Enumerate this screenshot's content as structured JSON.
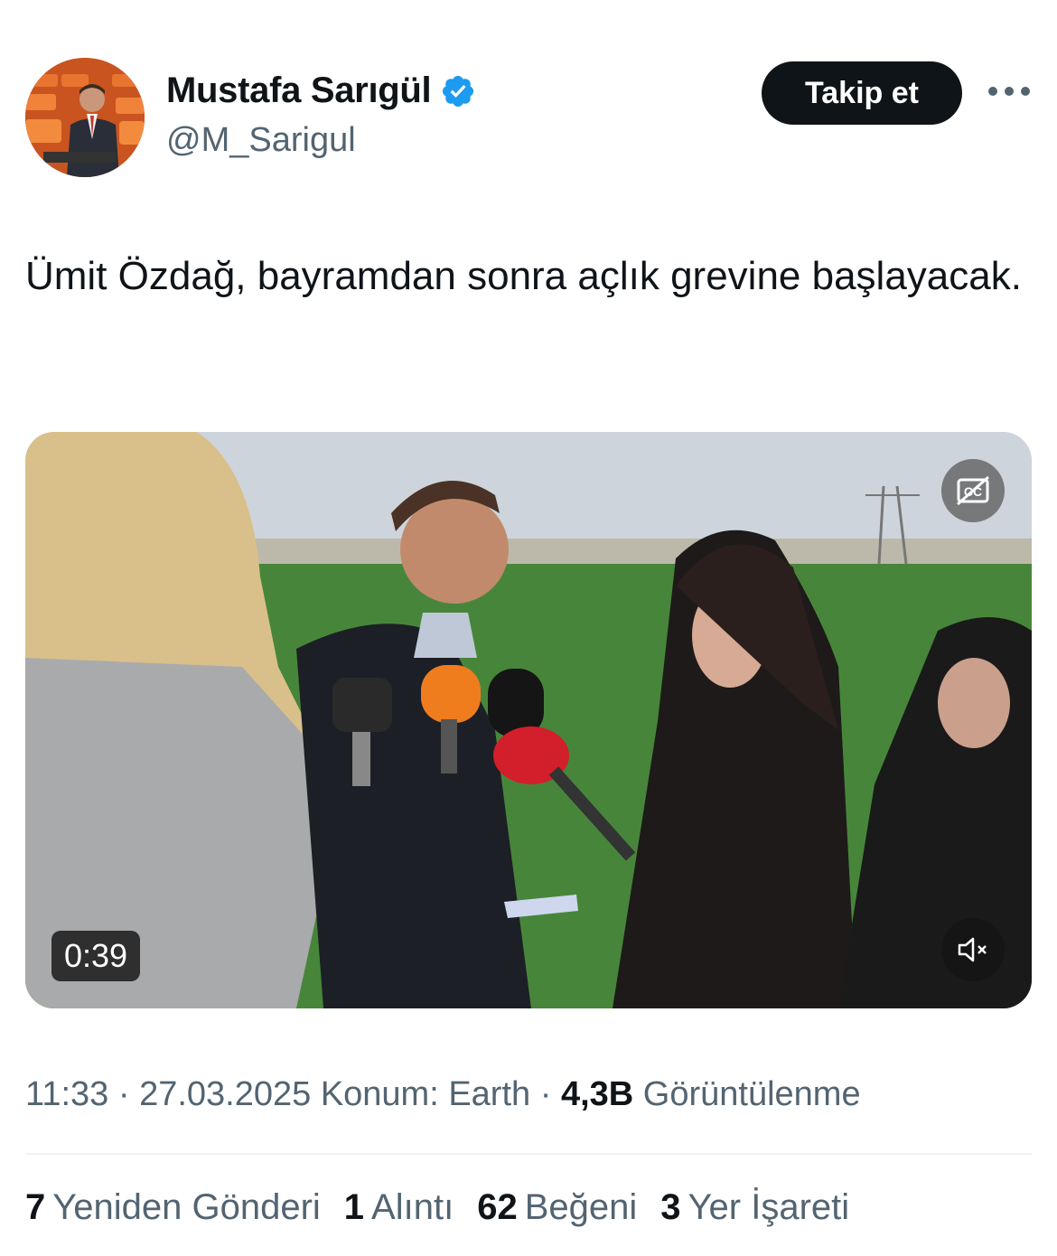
{
  "author": {
    "display_name": "Mustafa Sarıgül",
    "handle": "@M_Sarigul",
    "verified_color": "#1d9bf0"
  },
  "header": {
    "follow_label": "Takip et",
    "more_icon": "more-horizontal-icon"
  },
  "tweet": {
    "text": "Ümit Özdağ, bayramdan sonra açlık grevine başlayacak."
  },
  "media": {
    "duration": "0:39",
    "cc_icon": "closed-captions-off-icon",
    "mute_icon": "volume-muted-icon"
  },
  "meta": {
    "time": "11:33",
    "date": "27.03.2025",
    "location": "Konum: Earth",
    "views_count": "4,3B",
    "views_label": "Görüntülenme"
  },
  "stats": {
    "reposts_count": "7",
    "reposts_label": "Yeniden Gönderi",
    "quotes_count": "1",
    "quotes_label": "Alıntı",
    "likes_count": "62",
    "likes_label": "Beğeni",
    "bookmarks_count": "3",
    "bookmarks_label": "Yer İşareti"
  },
  "colors": {
    "text_primary": "#0f1419",
    "text_secondary": "#536471",
    "button_bg": "#0f1419",
    "divider": "#eff3f4"
  }
}
